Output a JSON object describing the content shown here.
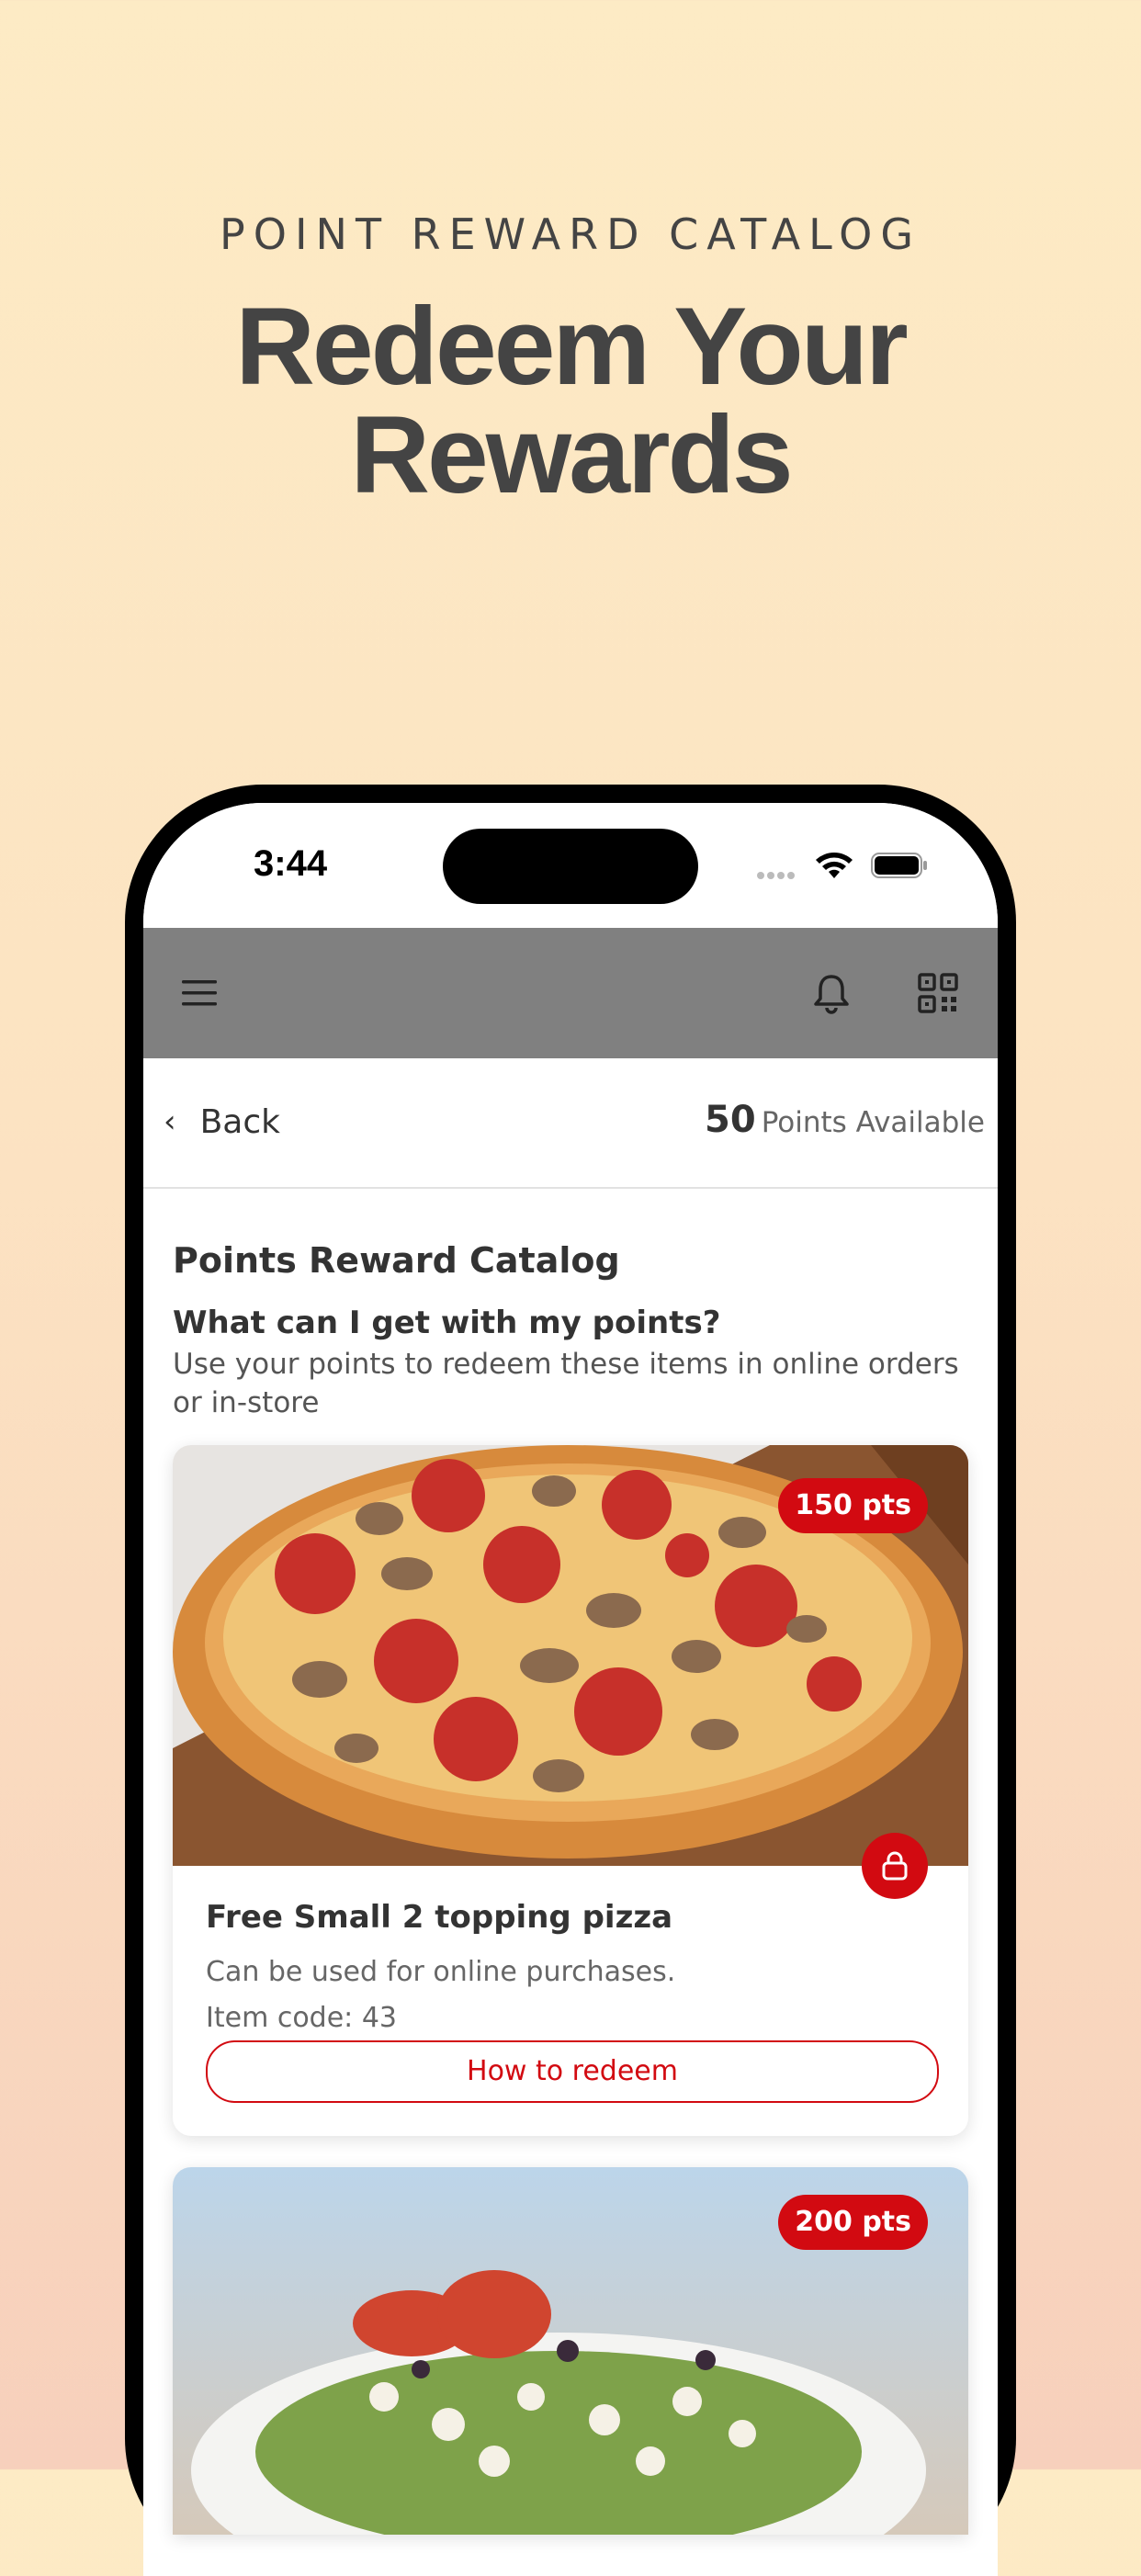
{
  "marketing": {
    "eyebrow": "POINT REWARD CATALOG",
    "headline_line1": "Redeem Your",
    "headline_line2": "Rewards"
  },
  "status_bar": {
    "time": "3:44"
  },
  "app_bar": {
    "icons": [
      "hamburger-menu-icon",
      "bell-icon",
      "qr-code-icon"
    ],
    "background_color": "#808080"
  },
  "nav": {
    "back_label": "Back",
    "points_value": "50",
    "points_label": "Points Available"
  },
  "catalog": {
    "title": "Points Reward Catalog",
    "question": "What can I get with my points?",
    "description": "Use your points to redeem these items in online orders or in-store",
    "items": [
      {
        "points": "150 pts",
        "name": "Free Small 2 topping pizza",
        "note": "Can be used for online purchases.",
        "item_code": "Item code: 43",
        "redeem_label": "How to redeem",
        "locked": true
      },
      {
        "points": "200 pts"
      }
    ]
  },
  "colors": {
    "accent_red": "#d20a11",
    "text_dark": "#333333"
  }
}
